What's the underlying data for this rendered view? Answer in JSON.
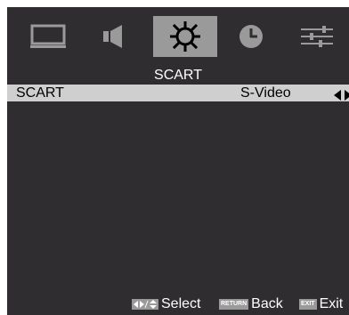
{
  "menu": {
    "tabs": [
      {
        "icon": "picture-icon",
        "selected": false
      },
      {
        "icon": "speaker-icon",
        "selected": false
      },
      {
        "icon": "gear-icon",
        "selected": true
      },
      {
        "icon": "clock-icon",
        "selected": false
      },
      {
        "icon": "sliders-icon",
        "selected": false
      }
    ],
    "section_title": "SCART"
  },
  "setting": {
    "label": "SCART",
    "value": "S-Video",
    "arrows_icon": "left-right-arrows-icon"
  },
  "footer": {
    "select_label": "Select",
    "return_key": "RETURN",
    "back_label": "Back",
    "exit_key": "EXIT",
    "exit_label": "Exit"
  },
  "colors": {
    "background": "#302d30",
    "selected_tab": "#9a9a9a",
    "highlight_row": "#cfcfcf",
    "text": "#ffffff"
  }
}
